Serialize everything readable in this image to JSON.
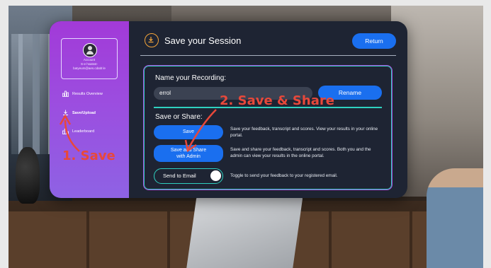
{
  "sidebar": {
    "account": {
      "label": "Account",
      "name": "S-e hsatsst-",
      "email": "batyeum@aes.cdatit le"
    },
    "items": [
      {
        "label": "Results Overview",
        "icon": "chart-icon"
      },
      {
        "label": "Save/Upload",
        "icon": "download-icon"
      },
      {
        "label": "Leaderboard",
        "icon": "leaderboard-icon"
      }
    ]
  },
  "header": {
    "title": "Save your Session",
    "return_label": "Return"
  },
  "recording": {
    "label": "Name your Recording:",
    "value": "errol",
    "rename_label": "Rename"
  },
  "save_share": {
    "label": "Save or Share:",
    "save_label": "Save",
    "save_desc": "Save your feedback, transcript and scores. View your results in your online portal.",
    "share_label_line1": "Save and Share",
    "share_label_line2": "with Admin",
    "share_desc": "Save and share your feedback, transcript and scores. Both you and the admin can view your results in the online portal.",
    "email_label": "Send to Email",
    "email_desc": "Toggle to send your feedback to your registered email."
  },
  "annotations": {
    "step1": "1.  Save",
    "step2": "2.  Save & Share"
  },
  "colors": {
    "accent_blue": "#1a6fef",
    "sidebar_purple": "#9b4fe0",
    "annotation_red": "#e8483a",
    "teal_border": "#2fd0c0"
  }
}
